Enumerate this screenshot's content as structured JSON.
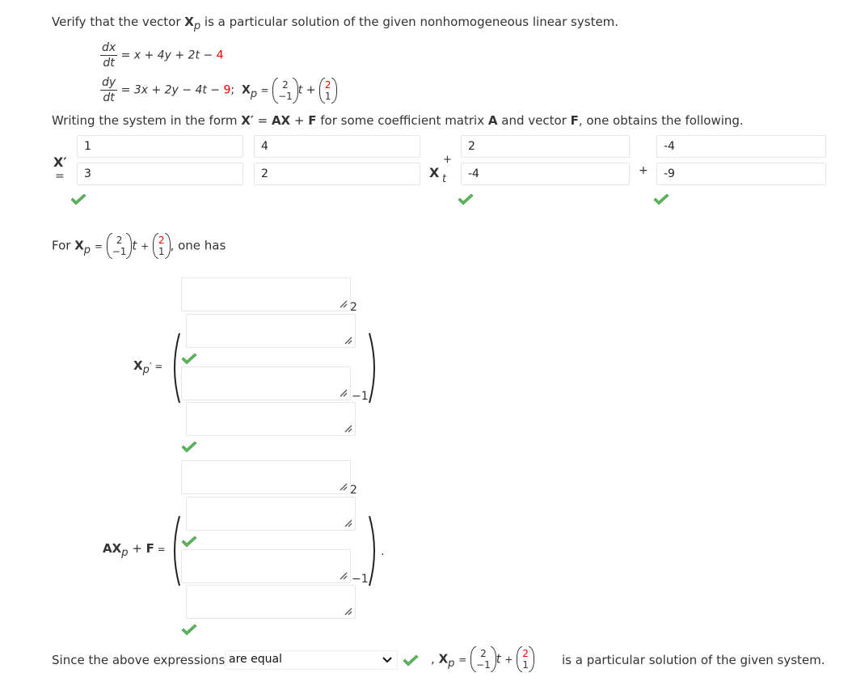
{
  "intro": {
    "prefix": "Verify that the vector ",
    "vector": "X",
    "vector_sub": "p",
    "suffix": " is a particular solution of the given nonhomogeneous linear system."
  },
  "system": {
    "eq1": {
      "num": "dx",
      "den": "dt",
      "rhs": "= x + 4y + 2t − ",
      "rhs_red": "4"
    },
    "eq2": {
      "num": "dy",
      "den": "dt",
      "rhs": "= 3x + 2y − 4t − ",
      "rhs_red": "9",
      "rhs_after": ";"
    },
    "xp_label": "X",
    "xp_sub": "p",
    "equals": "=",
    "vec1": [
      "2",
      "−1"
    ],
    "t": "t",
    "plus": "+",
    "vec2_top_red": "2",
    "vec2_bottom": "1"
  },
  "writing": {
    "p1": "Writing the system in the form ",
    "xprime": "X′",
    "eq": " = ",
    "ax": "AX",
    "plus": " + ",
    "f": "F",
    "p2": " for some coefficient matrix ",
    "a": "A",
    "p3": " and vector ",
    "f2": "F",
    "p4": ", one obtains the following."
  },
  "matrix_eq": {
    "lhs_label": "X′",
    "lhs_eq": "=",
    "A": [
      [
        "1",
        "4"
      ],
      [
        "3",
        "2"
      ]
    ],
    "x_label": "X",
    "t_label": "t",
    "plus_top": "+",
    "tcoef": [
      "2",
      "-4"
    ],
    "plus_f": "+",
    "F": [
      "-4",
      "-9"
    ]
  },
  "for_xp": {
    "for": "For ",
    "xp": "X",
    "xp_sub": "p",
    "eq": "=",
    "vec1": [
      "2",
      "−1"
    ],
    "t": "t",
    "plus": "+",
    "vec2_top_red": "2",
    "vec2_bottom": "1",
    "suffix": ", one has"
  },
  "xp_prime": {
    "label": "X",
    "sub": "p",
    "prime_eq": "′ =",
    "top_row_exp": "2",
    "bottom_row_exp": "−1",
    "boxes": [
      "",
      "",
      "",
      ""
    ]
  },
  "axpf": {
    "label_ax": "AX",
    "sub": "p",
    "plus": " + ",
    "f": "F",
    "eq": " =",
    "top_row_exp": "2",
    "bottom_row_exp": "−1",
    "boxes": [
      "",
      "",
      "",
      ""
    ],
    "period": "."
  },
  "conclusion": {
    "prefix": "Since the above expressions",
    "select_value": "are equal",
    "comma": ",",
    "xp": "X",
    "xp_sub": "p",
    "eq": "=",
    "vec1": [
      "2",
      "−1"
    ],
    "t": "t",
    "plus": "+",
    "vec2_top_red": "2",
    "vec2_bottom": "1",
    "suffix": "is a particular solution of the given system."
  },
  "colors": {
    "accent_red": "#e00000",
    "check_green": "#5cb85c"
  }
}
